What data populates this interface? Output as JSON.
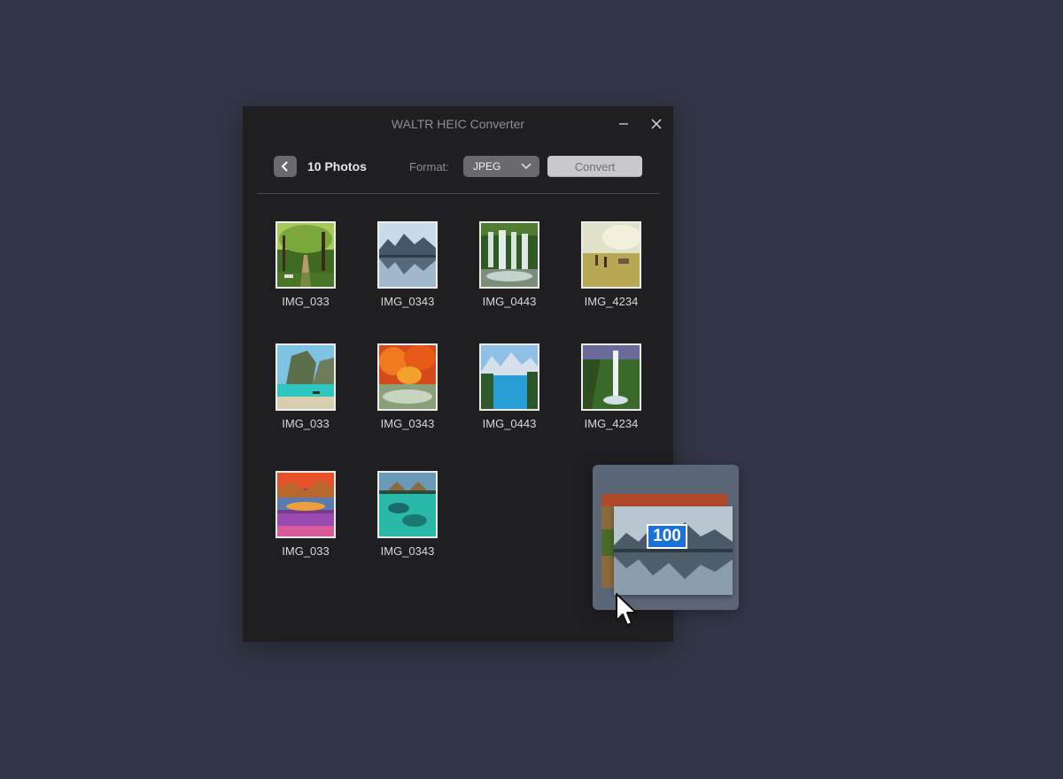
{
  "window": {
    "title": "WALTR HEIC Converter"
  },
  "toolbar": {
    "photo_count": "10 Photos",
    "format_label": "Format:",
    "format_value": "JPEG",
    "convert_label": "Convert"
  },
  "photos": [
    {
      "name": "IMG_033",
      "scene": "forest-path"
    },
    {
      "name": "IMG_0343",
      "scene": "mountain-lake"
    },
    {
      "name": "IMG_0443",
      "scene": "waterfall-curtain"
    },
    {
      "name": "IMG_4234",
      "scene": "meadow-hikers"
    },
    {
      "name": "IMG_033",
      "scene": "tropical-cliffs"
    },
    {
      "name": "IMG_0343",
      "scene": "autumn-river"
    },
    {
      "name": "IMG_0443",
      "scene": "alpine-lake"
    },
    {
      "name": "IMG_4234",
      "scene": "green-waterfall"
    },
    {
      "name": "IMG_033",
      "scene": "sunset-flowers"
    },
    {
      "name": "IMG_0343",
      "scene": "reef-bungalows"
    }
  ],
  "drag": {
    "count": "100"
  },
  "colors": {
    "desktop": "#333646",
    "window": "#1f1f21",
    "accent": "#1c71d8"
  },
  "icons": [
    "minimize-icon",
    "close-icon",
    "chevron-left-icon",
    "chevron-down-icon",
    "mouse-pointer-icon"
  ]
}
